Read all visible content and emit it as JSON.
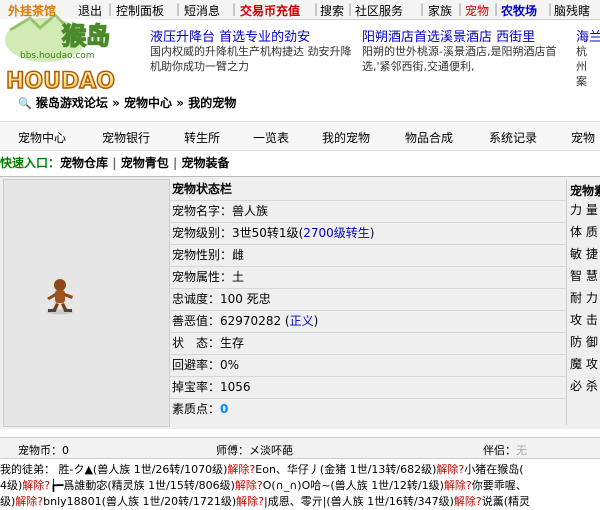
{
  "topbar": {
    "items": [
      "外挂茶馆",
      "退出",
      "控制面板",
      "短消息",
      "交易币充值",
      "搜索",
      "社区服务",
      "家族",
      "宠物",
      "农牧场",
      "脑残瞎"
    ]
  },
  "logo": {
    "text": "猴岛",
    "site": "bbs.houdao.com",
    "wordmark": "HOUDAO"
  },
  "ads": [
    {
      "title": "液压升降台 首选专业的劲安",
      "desc": "国内权威的升降机生产机构捷达 劲安升降机助你成功一臂之力"
    },
    {
      "title": "阳朔酒店首选溪景酒店 西街里",
      "desc": "阳朔的世外桃源-溪景酒店,是阳朔酒店首选,'紧邻西街,交通便利,"
    },
    {
      "title": "海兰",
      "desc": "杭州 案 美"
    }
  ],
  "breadcrumb": {
    "items": [
      "猴岛游戏论坛",
      "宠物中心",
      "我的宠物"
    ],
    "sep": "»"
  },
  "nav": {
    "items": [
      "宠物中心",
      "宠物银行",
      "转生所",
      "一览表",
      "我的宠物",
      "物品合成",
      "系统记录",
      "宠物"
    ]
  },
  "quick": {
    "label": "快速入口：",
    "links": [
      "宠物仓库",
      "宠物青包",
      "宠物装备"
    ]
  },
  "status_panel": {
    "title": "宠物状态栏",
    "rows": [
      {
        "label": "宠物名字：",
        "value": "兽人族"
      },
      {
        "label": "宠物级别：",
        "value": "3世50转1级",
        "extra": "2700级转生"
      },
      {
        "label": "宠物性别：",
        "value": "雌"
      },
      {
        "label": "宠物属性：",
        "value": "土"
      },
      {
        "label": "忠诚度：",
        "value": "100 死忠"
      },
      {
        "label": "善恶值：",
        "value": "62970282",
        "extra": "正义"
      },
      {
        "label": "状　态：",
        "value": "生存"
      },
      {
        "label": "回避率：",
        "value": "0%"
      },
      {
        "label": "掉宝率：",
        "value": "1056"
      },
      {
        "label": "素质点：",
        "value": "0"
      }
    ]
  },
  "attr_panel": {
    "title": "宠物素",
    "labels": [
      "力 量",
      "体 质",
      "敏 捷",
      "智 慧",
      "耐 力",
      "攻 击",
      "防 御",
      "魔 攻",
      "必 杀"
    ]
  },
  "bottombar": {
    "coin": "宠物币：0",
    "master": "师傅：メ淡吥葩",
    "partner_label": "伴侣：",
    "partner_value": "无"
  },
  "apprentices": {
    "label": "我的徒弟：",
    "line1": [
      {
        "t": "胜-ク▲(兽人族 1世/26转/1070级)",
        "c": ""
      },
      {
        "t": "解除?",
        "c": "red"
      },
      {
        "t": "Eon、华仔丿(金猪 1世/13转/682级)",
        "c": ""
      },
      {
        "t": "解除?",
        "c": "red"
      },
      {
        "t": "小猪在猴岛(",
        "c": ""
      }
    ],
    "line2": [
      {
        "t": "4级)",
        "c": ""
      },
      {
        "t": "解除?",
        "c": "red"
      },
      {
        "t": "┢━爲誰動宓(精灵族 1世/15转/806级)",
        "c": ""
      },
      {
        "t": "解除?",
        "c": "red"
      },
      {
        "t": "O(∩_∩)O哈~(兽人族 1世/12转/1级)",
        "c": ""
      },
      {
        "t": "解除?",
        "c": "red"
      },
      {
        "t": "你要乖喔、",
        "c": ""
      }
    ],
    "line3": [
      {
        "t": "级)",
        "c": ""
      },
      {
        "t": "解除?",
        "c": "red"
      },
      {
        "t": "bnly18801(兽人族 1世/20转/1721级)",
        "c": ""
      },
      {
        "t": "解除?",
        "c": "red"
      },
      {
        "t": "|成恩、零亓|(兽人族 1世/16转/347级)",
        "c": ""
      },
      {
        "t": "解除?",
        "c": "red"
      },
      {
        "t": "说薰(精灵",
        "c": ""
      }
    ]
  },
  "colors": {
    "link": "#0000cc",
    "red": "#cc0000",
    "panel": "#efefef"
  }
}
